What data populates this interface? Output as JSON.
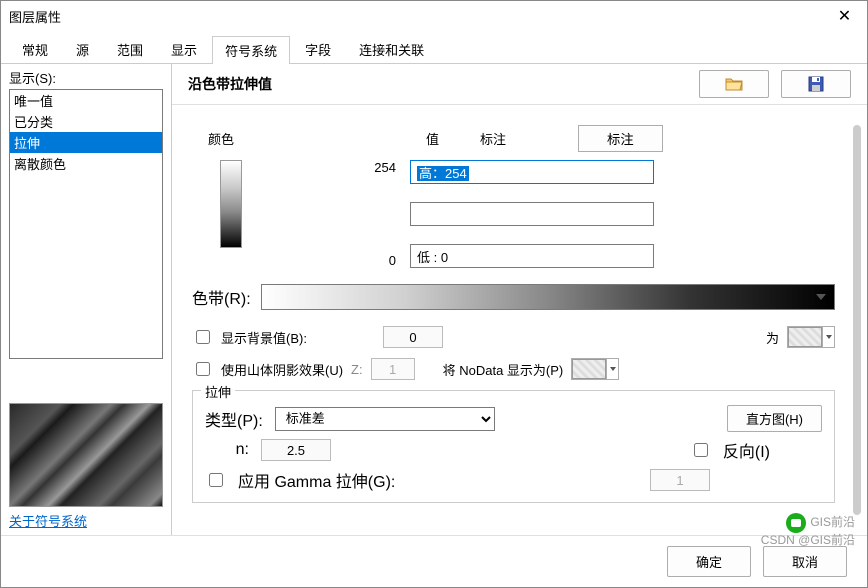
{
  "title": "图层属性",
  "tabs": [
    "常规",
    "源",
    "范围",
    "显示",
    "符号系统",
    "字段",
    "连接和关联"
  ],
  "active_tab_index": 4,
  "left": {
    "show_label": "显示(S):",
    "methods": [
      "唯一值",
      "已分类",
      "拉伸",
      "离散颜色"
    ],
    "selected_index": 2,
    "about_link": "关于符号系统"
  },
  "right": {
    "header_title": "沿色带拉伸值",
    "color_label": "颜色",
    "value_header": "值",
    "label_header": "标注",
    "label_btn": "标注",
    "high_value": "254",
    "high_label_prefix": "高：",
    "high_label_val": "254",
    "low_value": "0",
    "low_label": "低 : 0",
    "ramp_label": "色带(R):",
    "bg_chk": "显示背景值(B):",
    "bg_val": "0",
    "bg_as": "为",
    "hillshade_chk": "使用山体阴影效果(U)",
    "z_label": "Z:",
    "z_val": "1",
    "nodata_label": "将 NoData 显示为(P)",
    "stretch_legend": "拉伸",
    "type_label": "类型(P):",
    "type_selected": "标准差",
    "hist_btn": "直方图(H)",
    "n_label": "n:",
    "n_val": "2.5",
    "invert_chk": "反向(I)",
    "gamma_chk": "应用 Gamma 拉伸(G):",
    "gamma_val": "1"
  },
  "footer": {
    "ok": "确定",
    "cancel": "取消"
  },
  "watermark": {
    "line1": "GIS前沿",
    "line2": "CSDN @GIS前沿"
  }
}
